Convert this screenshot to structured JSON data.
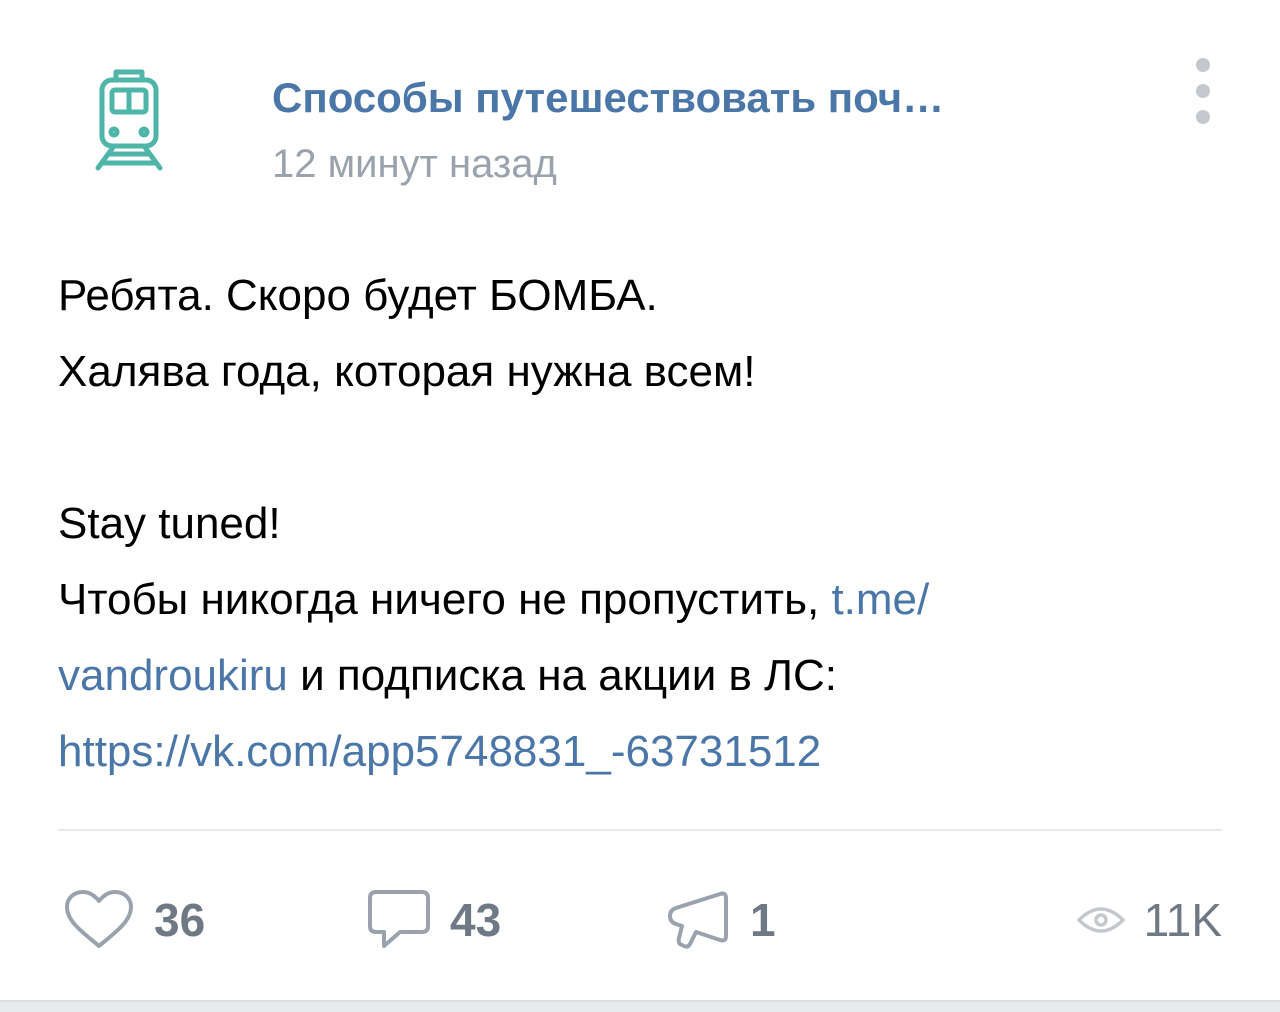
{
  "post": {
    "group_name": "Способы путешествовать поч…",
    "time": "12 минут назад",
    "avatar_icon": "train-icon",
    "more_icon": "more-vertical-icon",
    "text": {
      "line1": "Ребята. Скоро будет БОМБА.",
      "line2": "Халява года, которая нужна всем!",
      "line3": "Stay tuned!",
      "line4_text": "Чтобы никогда ничего не пропустить, ",
      "link1_part1": "t.me/",
      "link1_part2": "vandroukiru",
      "line5_text": " и подписка на акции в ЛС:",
      "link2": "https://vk.com/app5748831_-63731512"
    }
  },
  "footer": {
    "likes": "36",
    "comments": "43",
    "shares": "1",
    "views": "11K",
    "icons": {
      "like": "heart-icon",
      "comment": "comment-icon",
      "share": "share-icon",
      "views": "eye-icon"
    }
  },
  "colors": {
    "accent": "#4a76a8",
    "avatar": "#4fb5a8",
    "secondary_text": "#99a2ad",
    "icon": "#99a2ad"
  }
}
